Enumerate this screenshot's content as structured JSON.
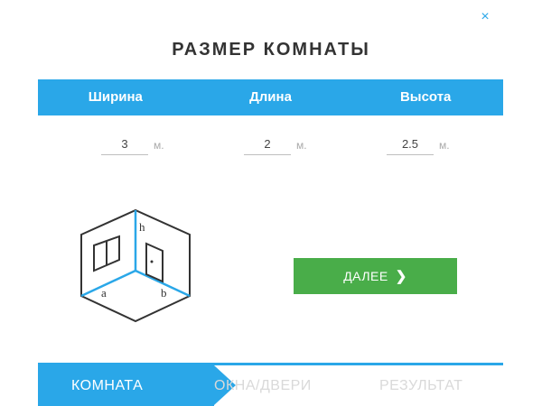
{
  "dialog": {
    "close_label": "×",
    "title": "РАЗМЕР КОМНАТЫ"
  },
  "columns": [
    {
      "label": "Ширина",
      "value": "3",
      "unit": "м."
    },
    {
      "label": "Длина",
      "value": "2",
      "unit": "м."
    },
    {
      "label": "Высота",
      "value": "2.5",
      "unit": "м."
    }
  ],
  "diagram": {
    "label_h": "h",
    "label_a": "a",
    "label_b": "b"
  },
  "next_button": {
    "label": "ДАЛЕЕ",
    "chevron": "❯"
  },
  "steps": [
    {
      "label": "КОМНАТА",
      "active": true
    },
    {
      "label": "ОКНА/ДВЕРИ",
      "active": false
    },
    {
      "label": "РЕЗУЛЬТАТ",
      "active": false
    }
  ],
  "colors": {
    "accent": "#2aa7e8",
    "button": "#49ad49",
    "inactive_step": "#d9d9d9"
  }
}
